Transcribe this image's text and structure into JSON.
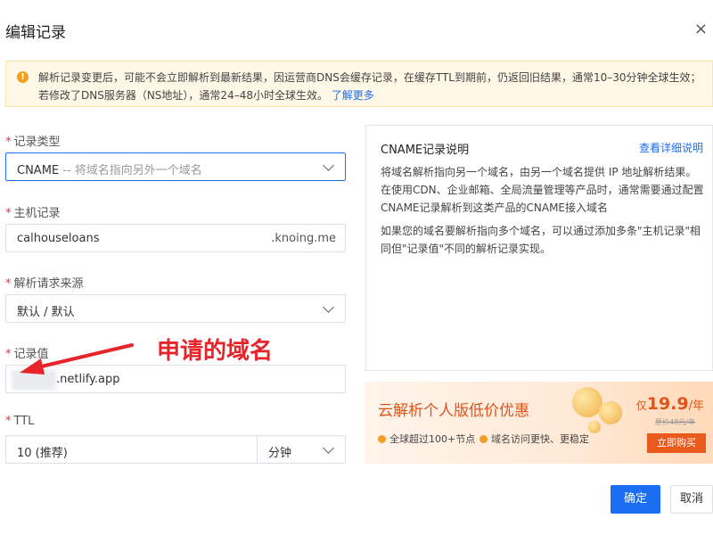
{
  "dialog": {
    "title": "编辑记录",
    "close_icon": "×"
  },
  "notice": {
    "icon": "!",
    "text": "解析记录变更后，可能不会立即解析到最新结果，因运营商DNS会缓存记录，在缓存TTL到期前，仍返回旧结果，通常10–30分钟全球生效；若修改了DNS服务器（NS地址），通常24–48小时全球生效。",
    "link": "了解更多"
  },
  "form": {
    "record_type": {
      "label": "记录类型",
      "value": "CNAME",
      "hint": " -- 将域名指向另外一个域名"
    },
    "host": {
      "label": "主机记录",
      "value": "calhouseloans",
      "suffix": ".knoing.me"
    },
    "source": {
      "label": "解析请求来源",
      "value": "默认 / 默认"
    },
    "record_value": {
      "label": "记录值",
      "value": ".netlify.app"
    },
    "ttl": {
      "label": "TTL",
      "value": "10 (推荐)",
      "unit": "分钟"
    },
    "required_mark": "*"
  },
  "annotation": {
    "text": "申请的域名",
    "color": "#e8242b"
  },
  "help_panel": {
    "title": "CNAME记录说明",
    "link": "查看详细说明",
    "para1": "将域名解析指向另一个域名，由另一个域名提供 IP 地址解析结果。在使用CDN、企业邮箱、全局流量管理等产品时，通常需要通过配置CNAME记录解析到这类产品的CNAME接入域名",
    "para2": "如果您的域名要解析指向多个域名，可以通过添加多条\"主机记录\"相同但\"记录值\"不同的解析记录实现。"
  },
  "promo": {
    "title": "云解析个人版低价优惠",
    "price_prefix": "仅",
    "price": "19.9",
    "price_unit": "/年",
    "original": "原价48元/年",
    "feature1": "全球超过100+节点",
    "feature2": "域名访问更快、更稳定",
    "button": "立即购买"
  },
  "actions": {
    "ok": "确定",
    "cancel": "取消"
  },
  "colors": {
    "primary": "#1a6ef2",
    "promo_orange": "#e2531a"
  }
}
